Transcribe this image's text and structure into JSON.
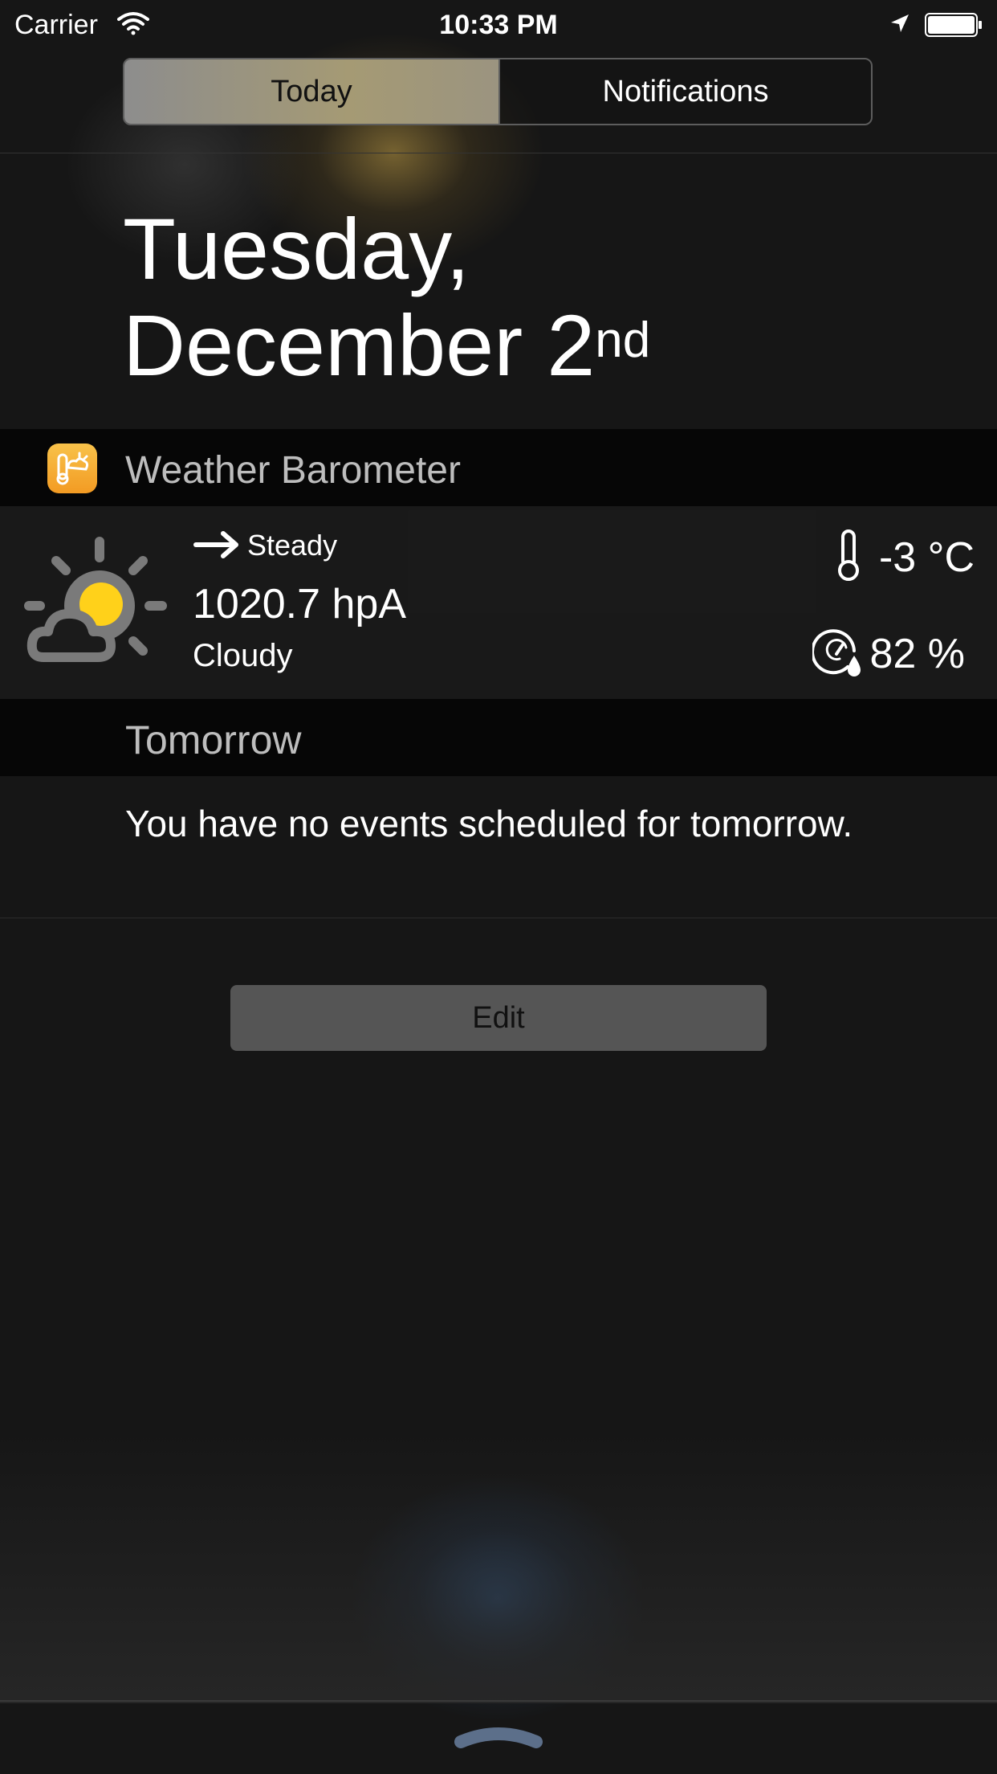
{
  "status_bar": {
    "carrier": "Carrier",
    "time": "10:33 PM",
    "icons": [
      "wifi-icon",
      "location-icon",
      "battery-icon"
    ]
  },
  "segmented_control": {
    "tabs": [
      {
        "label": "Today",
        "selected": true
      },
      {
        "label": "Notifications",
        "selected": false
      }
    ]
  },
  "date": {
    "line1": "Tuesday,",
    "line2": "December 2",
    "suffix": "nd"
  },
  "weather_widget": {
    "title": "Weather Barometer",
    "app_icon": "weather-barometer-app-icon",
    "condition_icon": "partly-cloudy-icon",
    "trend_icon": "arrow-right-icon",
    "trend": "Steady",
    "pressure": "1020.7 hpA",
    "condition": "Cloudy",
    "temperature": "-3 °C",
    "humidity": "82 %"
  },
  "tomorrow": {
    "label": "Tomorrow",
    "message": "You have no events scheduled for tomorrow."
  },
  "edit_button": {
    "label": "Edit"
  },
  "colors": {
    "background": "#161616",
    "app_icon": "#f5ae33",
    "sun": "#ffd11a",
    "edit_button": "#555555"
  }
}
